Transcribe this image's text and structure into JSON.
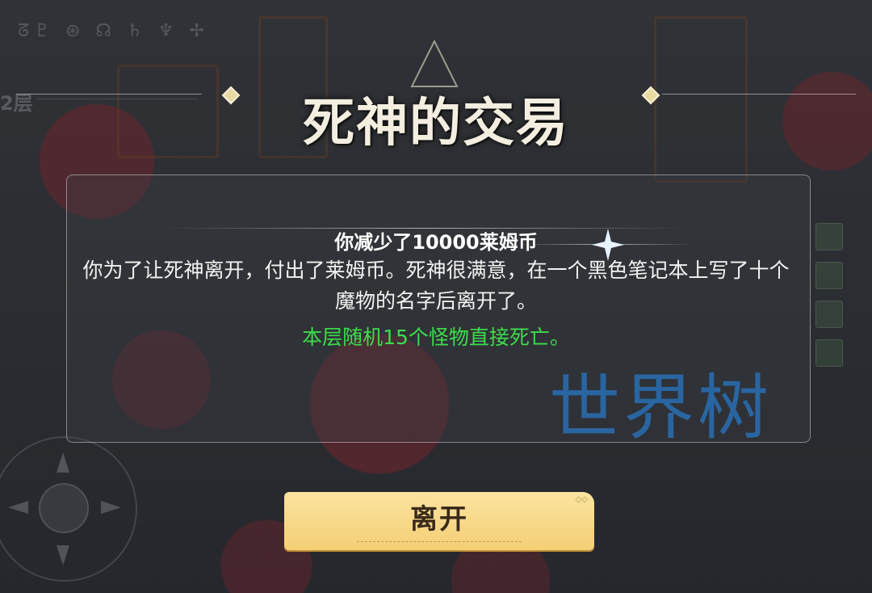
{
  "background": {
    "floor_label": "2层",
    "top_runes": "ᘔ♇ ⊛ ☊ ♄ ♆ ✢"
  },
  "dialog": {
    "title": "死神的交易",
    "headline": "你减少了10000莱姆币",
    "description": "你为了让死神离开，付出了莱姆币。死神很满意，在一个黑色笔记本上写了十个魔物的名字后离开了。",
    "effect": "本层随机15个怪物直接死亡。",
    "effect_color": "#3ddc4c",
    "leave_button": "离开"
  },
  "watermark": "世界树",
  "colors": {
    "button_fill": "#f4cf75",
    "title_text": "#f3eee0",
    "watermark": "#2a6eb4"
  }
}
